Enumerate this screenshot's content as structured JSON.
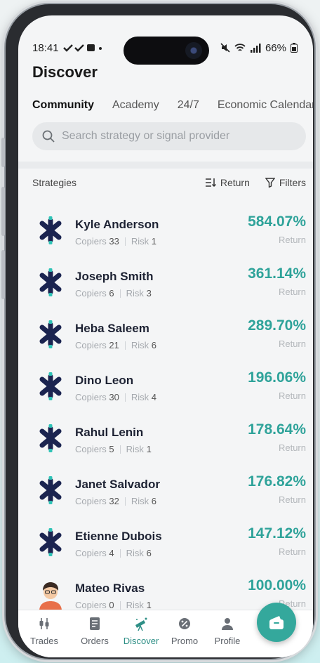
{
  "status": {
    "time": "18:41",
    "right_text": "66%"
  },
  "header": {
    "title": "Discover"
  },
  "tabs": [
    {
      "label": "Community",
      "active": true
    },
    {
      "label": "Academy",
      "active": false
    },
    {
      "label": "24/7",
      "active": false
    },
    {
      "label": "Economic Calendar",
      "active": false
    }
  ],
  "search": {
    "placeholder": "Search strategy or signal provider"
  },
  "strategies": {
    "label": "Strategies",
    "sort_label": "Return",
    "filters_label": "Filters"
  },
  "list": [
    {
      "name": "Kyle Anderson",
      "copiers_label": "Copiers",
      "copiers": "33",
      "risk_label": "Risk",
      "risk": "1",
      "return": "584.07%",
      "return_label": "Return",
      "avatar": "logo-icon"
    },
    {
      "name": "Joseph Smith",
      "copiers_label": "Copiers",
      "copiers": "6",
      "risk_label": "Risk",
      "risk": "3",
      "return": "361.14%",
      "return_label": "Return",
      "avatar": "logo-icon"
    },
    {
      "name": "Heba Saleem",
      "copiers_label": "Copiers",
      "copiers": "21",
      "risk_label": "Risk",
      "risk": "6",
      "return": "289.70%",
      "return_label": "Return",
      "avatar": "logo-icon"
    },
    {
      "name": "Dino Leon",
      "copiers_label": "Copiers",
      "copiers": "30",
      "risk_label": "Risk",
      "risk": "4",
      "return": "196.06%",
      "return_label": "Return",
      "avatar": "logo-icon"
    },
    {
      "name": "Rahul Lenin",
      "copiers_label": "Copiers",
      "copiers": "5",
      "risk_label": "Risk",
      "risk": "1",
      "return": "178.64%",
      "return_label": "Return",
      "avatar": "logo-icon"
    },
    {
      "name": "Janet Salvador",
      "copiers_label": "Copiers",
      "copiers": "32",
      "risk_label": "Risk",
      "risk": "6",
      "return": "176.82%",
      "return_label": "Return",
      "avatar": "logo-icon"
    },
    {
      "name": "Etienne Dubois",
      "copiers_label": "Copiers",
      "copiers": "4",
      "risk_label": "Risk",
      "risk": "6",
      "return": "147.12%",
      "return_label": "Return",
      "avatar": "logo-icon"
    },
    {
      "name": "Mateo Rivas",
      "copiers_label": "Copiers",
      "copiers": "0",
      "risk_label": "Risk",
      "risk": "1",
      "return": "100.00%",
      "return_label": "Return",
      "avatar": "person-avatar"
    }
  ],
  "nav": [
    {
      "label": "Trades",
      "icon": "trades-icon",
      "active": false
    },
    {
      "label": "Orders",
      "icon": "orders-icon",
      "active": false
    },
    {
      "label": "Discover",
      "icon": "discover-icon",
      "active": true
    },
    {
      "label": "Promo",
      "icon": "promo-icon",
      "active": false
    },
    {
      "label": "Profile",
      "icon": "profile-icon",
      "active": false
    }
  ],
  "colors": {
    "accent": "#34a89c",
    "return_text": "#2fa39a",
    "name_text": "#1d2233"
  }
}
